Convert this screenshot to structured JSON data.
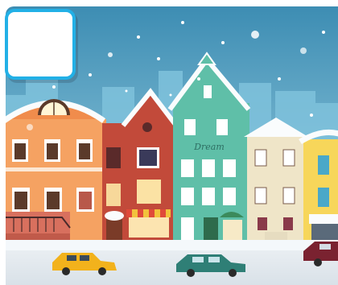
{
  "scene": {
    "sign_text": "Dream",
    "colors": {
      "sky_top": "#3f8fb5",
      "sky_bottom": "#a8d8e8",
      "snow": "#f3f7fa",
      "road": "#dfe6ec",
      "slot_border": "#22b0e6"
    }
  },
  "slot": {
    "icon": "empty-slot"
  },
  "cars": [
    {
      "name": "taxi",
      "color": "#f2b21c"
    },
    {
      "name": "green-car",
      "color": "#2f7f76"
    },
    {
      "name": "red-car",
      "color": "#7a2230"
    }
  ]
}
